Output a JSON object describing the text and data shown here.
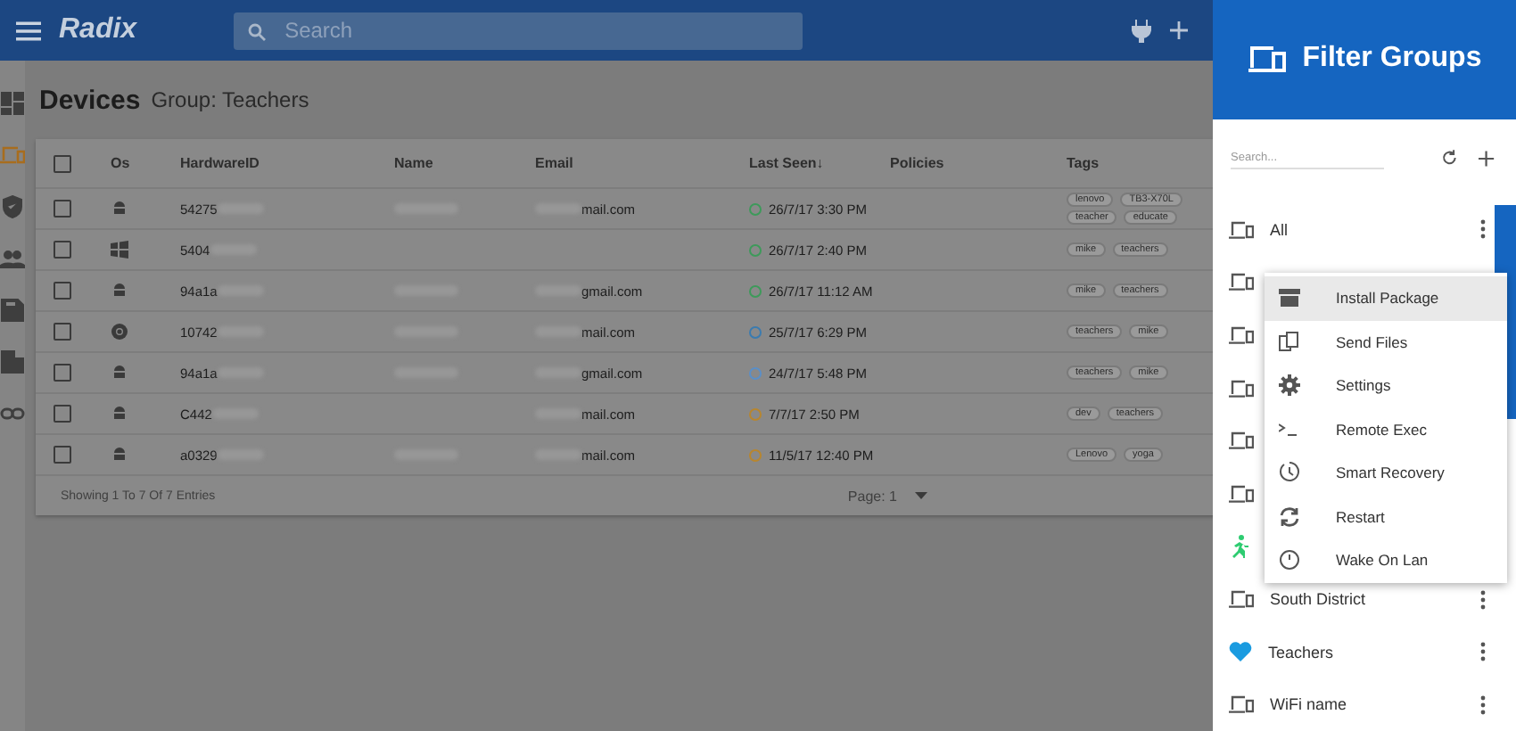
{
  "topbar": {
    "logo": "Radix",
    "search": {
      "placeholder": "Search"
    }
  },
  "sidebar": {
    "items": [
      {
        "kind": "dashboard",
        "selected": false
      },
      {
        "kind": "devices",
        "selected": true
      },
      {
        "kind": "shield",
        "selected": false
      },
      {
        "kind": "people",
        "selected": false
      },
      {
        "kind": "save",
        "selected": false
      },
      {
        "kind": "building",
        "selected": false
      },
      {
        "kind": "link",
        "selected": false
      }
    ]
  },
  "page": {
    "title": "Devices",
    "subtitle": "Group: Teachers"
  },
  "table": {
    "all_checked": false,
    "columns": [
      "Os",
      "HardwareID",
      "Name",
      "Email",
      "Last Seen",
      "Policies",
      "Tags"
    ],
    "sort_mark": "↓",
    "rows": [
      {
        "checked": false,
        "kind": "android",
        "hardware_id": "54275",
        "name_blurred": true,
        "email": "mail.com",
        "last_seen": "26/7/17 3:30 PM",
        "color": "#3d9a5a",
        "tags": [
          "lenovo",
          "TB3-X70L",
          "teacher",
          "educate"
        ]
      },
      {
        "checked": false,
        "kind": "windows",
        "hardware_id": "5404",
        "name_blurred": false,
        "email": "",
        "last_seen": "26/7/17 2:40 PM",
        "color": "#3d9a5a",
        "tags": [
          "mike",
          "teachers"
        ]
      },
      {
        "checked": false,
        "kind": "android",
        "hardware_id": "94a1a",
        "name_blurred": true,
        "email": "gmail.com",
        "last_seen": "26/7/17 11:12 AM",
        "color": "#3d9a5a",
        "tags": [
          "mike",
          "teachers"
        ]
      },
      {
        "checked": false,
        "kind": "chrome",
        "hardware_id": "10742",
        "name_blurred": true,
        "email": "mail.com",
        "last_seen": "25/7/17 6:29 PM",
        "color": "#3a7bb0",
        "tags": [
          "teachers",
          "mike"
        ]
      },
      {
        "checked": false,
        "kind": "android",
        "hardware_id": "94a1a",
        "name_blurred": true,
        "email": "gmail.com",
        "last_seen": "24/7/17 5:48 PM",
        "color": "#5a8fc8",
        "tags": [
          "teachers",
          "mike"
        ]
      },
      {
        "checked": false,
        "kind": "android",
        "hardware_id": "C442",
        "name_blurred": false,
        "email": "mail.com",
        "last_seen": "7/7/17 2:50 PM",
        "color": "#b8862e",
        "tags": [
          "dev",
          "teachers"
        ]
      },
      {
        "checked": false,
        "kind": "android",
        "hardware_id": "a0329",
        "name_blurred": true,
        "email": "mail.com",
        "last_seen": "11/5/17 12:40 PM",
        "color": "#b8862e",
        "tags": [
          "Lenovo",
          "yoga"
        ]
      }
    ],
    "footer": "Showing 1 To 7 Of 7 Entries",
    "page": "Page: 1"
  },
  "drawer": {
    "title": "Filter Groups",
    "search": {
      "placeholder": "Search..."
    },
    "groups": [
      {
        "kind": "device",
        "label": "All",
        "menu": true
      },
      {
        "kind": "device"
      },
      {
        "kind": "device"
      },
      {
        "kind": "device"
      },
      {
        "kind": "device"
      },
      {
        "kind": "device"
      },
      {
        "kind": "runner"
      },
      {
        "kind": "device",
        "label": "South District",
        "menu": true
      },
      {
        "kind": "heart",
        "label": "Teachers",
        "menu": true
      },
      {
        "kind": "device",
        "label": "WiFi name",
        "menu": true
      }
    ],
    "context_menu": [
      {
        "kind": "package",
        "label": "Install Package",
        "selected": true
      },
      {
        "kind": "files",
        "label": "Send Files",
        "selected": false
      },
      {
        "kind": "gear",
        "label": "Settings",
        "selected": false
      },
      {
        "kind": "terminal",
        "label": "Remote Exec",
        "selected": false
      },
      {
        "kind": "clock",
        "label": "Smart Recovery",
        "selected": false
      },
      {
        "kind": "refresh",
        "label": "Restart",
        "selected": false
      },
      {
        "kind": "power",
        "label": "Wake On Lan",
        "selected": false
      }
    ]
  }
}
